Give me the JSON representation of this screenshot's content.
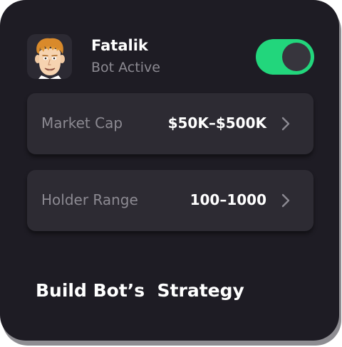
{
  "profile": {
    "name": "Fatalik",
    "status": "Bot Active",
    "bot_enabled": true
  },
  "settings": [
    {
      "label": "Market Cap",
      "value": "$50K–$500K"
    },
    {
      "label": "Holder Range",
      "value": "100–1000"
    }
  ],
  "section_title": "Build Bot’s  Strategy",
  "colors": {
    "card_bg": "#1e1c24",
    "row_bg": "#2d2b33",
    "accent": "#22d67c",
    "muted_text": "#8c8a92"
  },
  "icons": {
    "avatar": "cartoon-man-avatar",
    "chevron": "chevron-right-icon"
  }
}
